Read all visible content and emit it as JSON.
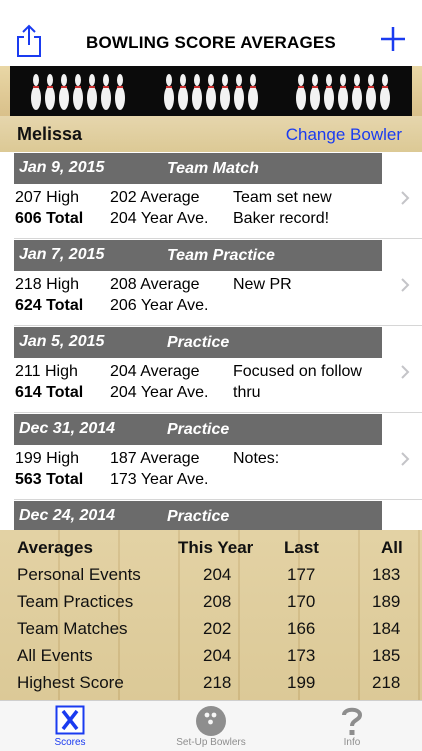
{
  "nav": {
    "title": "BOWLING SCORE AVERAGES"
  },
  "bowler": {
    "name": "Melissa",
    "change_label": "Change Bowler"
  },
  "entries": [
    {
      "date": "Jan 9, 2015",
      "type": "Team Match",
      "high": "207 High",
      "total": "606 Total",
      "average": "202 Average",
      "year_ave": "204 Year Ave.",
      "note1": "Team set new",
      "note2": "Baker record!"
    },
    {
      "date": "Jan 7, 2015",
      "type": "Team Practice",
      "high": "218 High",
      "total": "624 Total",
      "average": "208 Average",
      "year_ave": "206 Year Ave.",
      "note1": "New PR",
      "note2": ""
    },
    {
      "date": "Jan 5, 2015",
      "type": "Practice",
      "high": "211 High",
      "total": "614 Total",
      "average": "204 Average",
      "year_ave": "204 Year Ave.",
      "note1": "Focused on follow",
      "note2": "thru"
    },
    {
      "date": "Dec 31, 2014",
      "type": "Practice",
      "high": "199 High",
      "total": "563 Total",
      "average": "187 Average",
      "year_ave": "173 Year Ave.",
      "note1": "Notes:",
      "note2": ""
    },
    {
      "date": "Dec 24, 2014",
      "type": "Practice"
    }
  ],
  "averages": {
    "headers": [
      "Averages",
      "This Year",
      "Last",
      "All"
    ],
    "rows": [
      [
        "Personal Events",
        "204",
        "177",
        "183"
      ],
      [
        "Team Practices",
        "208",
        "170",
        "189"
      ],
      [
        "Team Matches",
        "202",
        "166",
        "184"
      ],
      [
        "All Events",
        "204",
        "173",
        "185"
      ],
      [
        "Highest Score",
        "218",
        "199",
        "218"
      ]
    ]
  },
  "tabs": [
    {
      "label": "Scores",
      "icon": "x-box-icon",
      "active": true
    },
    {
      "label": "Set-Up Bowlers",
      "icon": "bowling-ball-icon",
      "active": false
    },
    {
      "label": "Info",
      "icon": "question-icon",
      "active": false
    }
  ],
  "colors": {
    "accent": "#1a3bf0",
    "header_gray": "#6b6b6b",
    "wood": "#e0cd9a"
  }
}
